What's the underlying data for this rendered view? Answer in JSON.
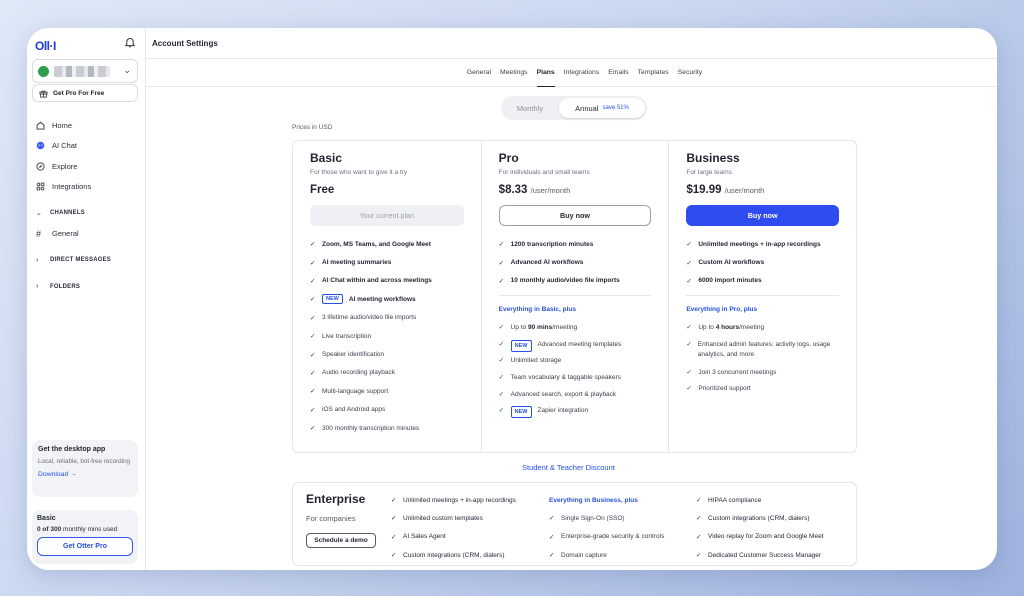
{
  "sidebar": {
    "logo": "Oll·I",
    "get_pro": "Get Pro For Free",
    "nav": [
      {
        "label": "Home",
        "icon": "home-icon"
      },
      {
        "label": "AI Chat",
        "icon": "ai-chat-icon"
      },
      {
        "label": "Explore",
        "icon": "compass-icon"
      },
      {
        "label": "Integrations",
        "icon": "grid-icon"
      }
    ],
    "channels_label": "CHANNELS",
    "channel_general": "General",
    "direct_messages_label": "DIRECT MESSAGES",
    "folders_label": "FOLDERS",
    "desktop_card": {
      "title": "Get the desktop app",
      "subtitle": "Local, reliable, bot-free recording",
      "link": "Download →"
    },
    "plan_card": {
      "plan": "Basic",
      "usage_bold": "0 of 300",
      "usage_rest": " monthly mins used",
      "button": "Get Otter Pro"
    }
  },
  "header": {
    "title": "Account Settings"
  },
  "tabs": [
    "General",
    "Meetings",
    "Plans",
    "Integrations",
    "Emails",
    "Templates",
    "Security"
  ],
  "active_tab": "Plans",
  "billing_toggle": {
    "monthly": "Monthly",
    "annual": "Annual",
    "save": "save 51%"
  },
  "prices_note": "Prices in USD",
  "plans": {
    "basic": {
      "name": "Basic",
      "subtitle": "For those who want to give it a try",
      "price": "Free",
      "button": "Your current plan",
      "features_bold": [
        "Zoom, MS Teams, and Google Meet",
        "AI meeting summaries",
        "AI Chat within and across meetings",
        "AI meeting workflows"
      ],
      "features": [
        "3 lifetime audio/video file imports",
        "Live transcription",
        "Speaker identification",
        "Audio recording playback",
        "Multi-language support",
        "iOS and Android apps",
        "300 monthly transcription minutes"
      ]
    },
    "pro": {
      "name": "Pro",
      "subtitle": "For individuals and small teams",
      "price": "$8.33",
      "unit": "/user/month",
      "button": "Buy now",
      "features_bold": [
        "1200 transcription minutes",
        "Advanced AI workflows",
        "10 monthly audio/video file imports"
      ],
      "plus_label": "Everything in Basic, plus",
      "plus_1_pre": "Up to ",
      "plus_1_bold": "90 mins",
      "plus_1_post": "/meeting",
      "plus_2": "Advanced meeting templates",
      "plus_3": "Unlimited storage",
      "plus_4": "Team vocabulary & taggable speakers",
      "plus_5": "Advanced search, export & playback",
      "plus_6": "Zapier integration"
    },
    "business": {
      "name": "Business",
      "subtitle": "For large teams",
      "price": "$19.99",
      "unit": "/user/month",
      "button": "Buy now",
      "features_bold": [
        "Unlimited meetings + in-app recordings",
        "Custom AI workflows",
        "6000 import minutes"
      ],
      "plus_label": "Everything in Pro, plus",
      "plus_1_pre": "Up to ",
      "plus_1_bold": "4 hours",
      "plus_1_post": "/meeting",
      "plus_2": "Enhanced admin features: activity logs, usage analytics, and more",
      "plus_3": "Join 3 concurrent meetings",
      "plus_4": "Prioritized support"
    }
  },
  "new_badge": "NEW",
  "student_discount": "Student & Teacher Discount",
  "enterprise": {
    "name": "Enterprise",
    "subtitle": "For companies",
    "button": "Schedule a demo",
    "col1": [
      "Unlimited meetings + in-app recordings",
      "Unlimited custom templates",
      "AI Sales Agent",
      "Custom integrations (CRM, dialers)"
    ],
    "col2_head": "Everything in Business, plus",
    "col2": [
      "Single Sign-On (SSO)",
      "Enterprise-grade security & controls",
      "Domain capture"
    ],
    "col3": [
      "HIPAA compliance",
      "Custom integrations (CRM, dialers)",
      "Video replay for Zoom and Google Meet",
      "Dedicated Customer Success Manager"
    ]
  },
  "colors": {
    "accent": "#2f4cf0",
    "link": "#2450e6"
  }
}
